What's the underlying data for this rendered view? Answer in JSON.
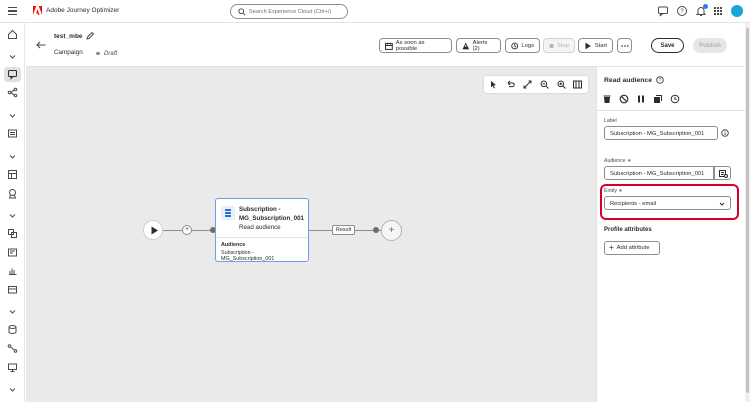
{
  "app": {
    "title": "Adobe Journey Optimizer"
  },
  "search": {
    "placeholder": "Search Experience Cloud (Ctrl+/)"
  },
  "header": {
    "name": "test_mbe",
    "type": "Campaign",
    "status": "Draft",
    "buttons": {
      "schedule": "As soon as possible",
      "alerts": "Alerts (2)",
      "logs": "Logs",
      "stop": "Stop",
      "start": "Start",
      "save": "Save",
      "publish": "Publish"
    }
  },
  "canvas": {
    "activity": {
      "title": "Subscription - MG_Subscription_001",
      "subtitle": "Read audience",
      "audience_label": "Audience",
      "audience_value": "Subscription - MG_Subscription_001"
    },
    "result_label": "Result"
  },
  "panel": {
    "title": "Read audience",
    "label_field": {
      "label": "Label",
      "value": "Subscription - MG_Subscription_001"
    },
    "audience_field": {
      "label": "Audience ∗",
      "value": "Subscription - MG_Subscription_001"
    },
    "entity_field": {
      "label": "Entity ∗",
      "value": "Recipients - email"
    },
    "profile_attributes": {
      "title": "Profile attributes",
      "add_label": "Add attribute"
    }
  },
  "colors": {
    "accent": "#2680eb",
    "highlight": "#d7002a",
    "adobe_red": "#eb1000"
  }
}
